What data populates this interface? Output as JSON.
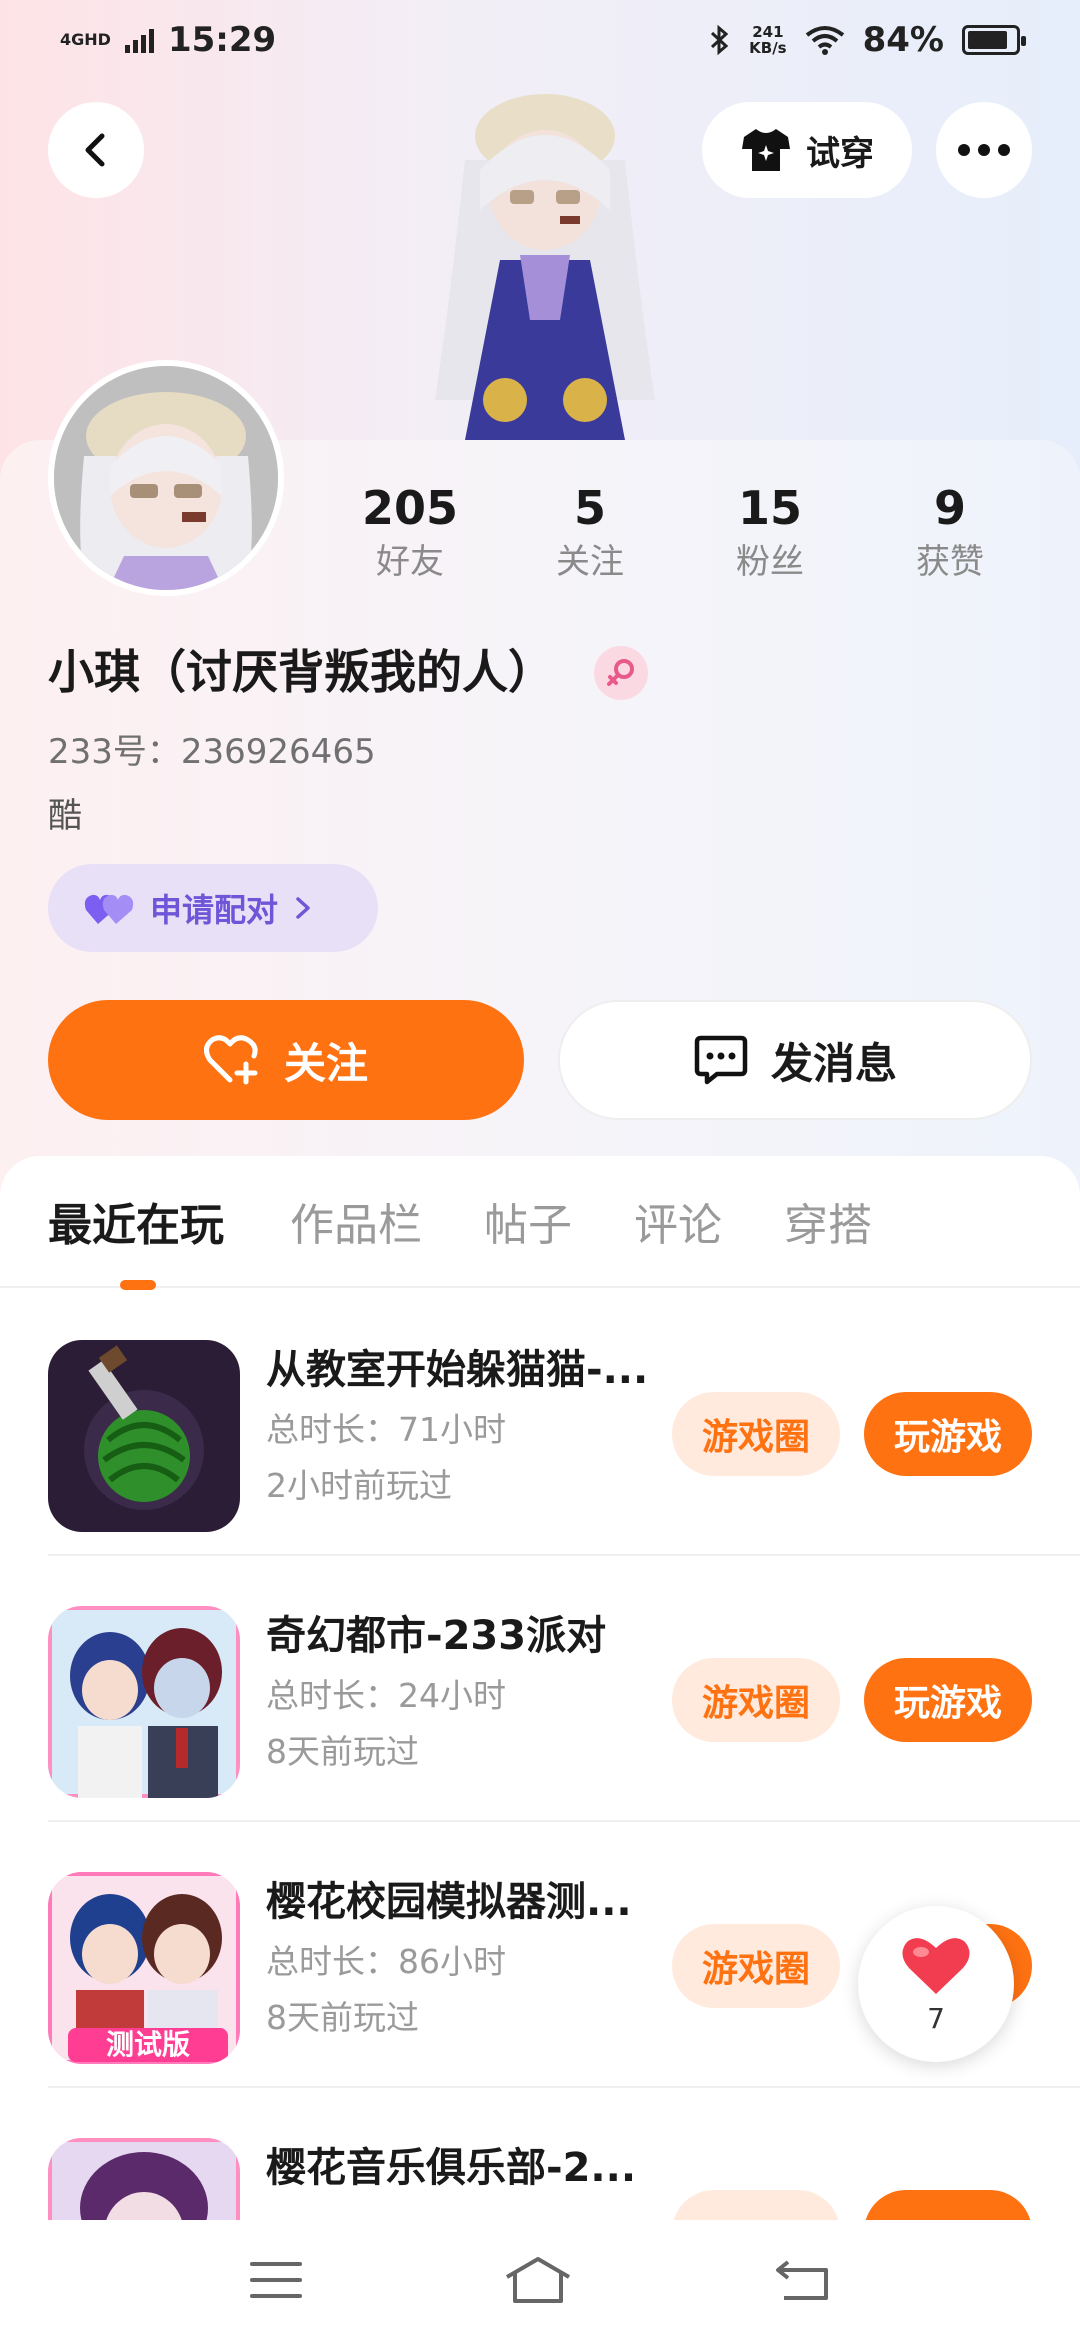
{
  "status_bar": {
    "network": "4GHD",
    "time": "15:29",
    "speed_value": "241",
    "speed_unit": "KB/s",
    "battery_percent": "84%",
    "battery_level": 0.84
  },
  "header": {
    "tryon_label": "试穿",
    "icons": [
      "back-arrow-icon",
      "tshirt-icon",
      "more-icon"
    ]
  },
  "profile": {
    "stats": [
      {
        "value": "205",
        "label": "好友"
      },
      {
        "value": "5",
        "label": "关注"
      },
      {
        "value": "15",
        "label": "粉丝"
      },
      {
        "value": "9",
        "label": "获赞"
      }
    ],
    "nickname": "小琪（讨厌背叛我的人）",
    "uid": "233号：236926465",
    "bio": "酷",
    "pair_label": "申请配对",
    "follow_label": "关注",
    "message_label": "发消息",
    "colors": {
      "accent": "#ff7212",
      "pair": "#6f55d8",
      "gender": "#e85a8c"
    }
  },
  "tabs": [
    {
      "label": "最近在玩",
      "active": true
    },
    {
      "label": "作品栏",
      "active": false
    },
    {
      "label": "帖子",
      "active": false
    },
    {
      "label": "评论",
      "active": false
    },
    {
      "label": "穿搭",
      "active": false
    }
  ],
  "games": [
    {
      "title": "从教室开始躲猫猫-...",
      "time": "总时长：71小时",
      "last_played": "2小时前玩过",
      "circle_label": "游戏圈",
      "play_label": "玩游戏"
    },
    {
      "title": "奇幻都市-233派对",
      "time": "总时长：24小时",
      "last_played": "8天前玩过",
      "circle_label": "游戏圈",
      "play_label": "玩游戏"
    },
    {
      "title": "樱花校园模拟器测...",
      "time": "总时长：86小时",
      "last_played": "8天前玩过",
      "circle_label": "游戏圈",
      "play_label": "玩游戏",
      "icon_badge": "测试版"
    },
    {
      "title": "樱花音乐俱乐部-2...",
      "time": "",
      "last_played": "",
      "circle_label": "",
      "play_label": ""
    }
  ],
  "like_float": {
    "count": "7"
  },
  "bottom_nav": {
    "icons": [
      "menu-icon",
      "home-icon",
      "back-icon"
    ]
  }
}
